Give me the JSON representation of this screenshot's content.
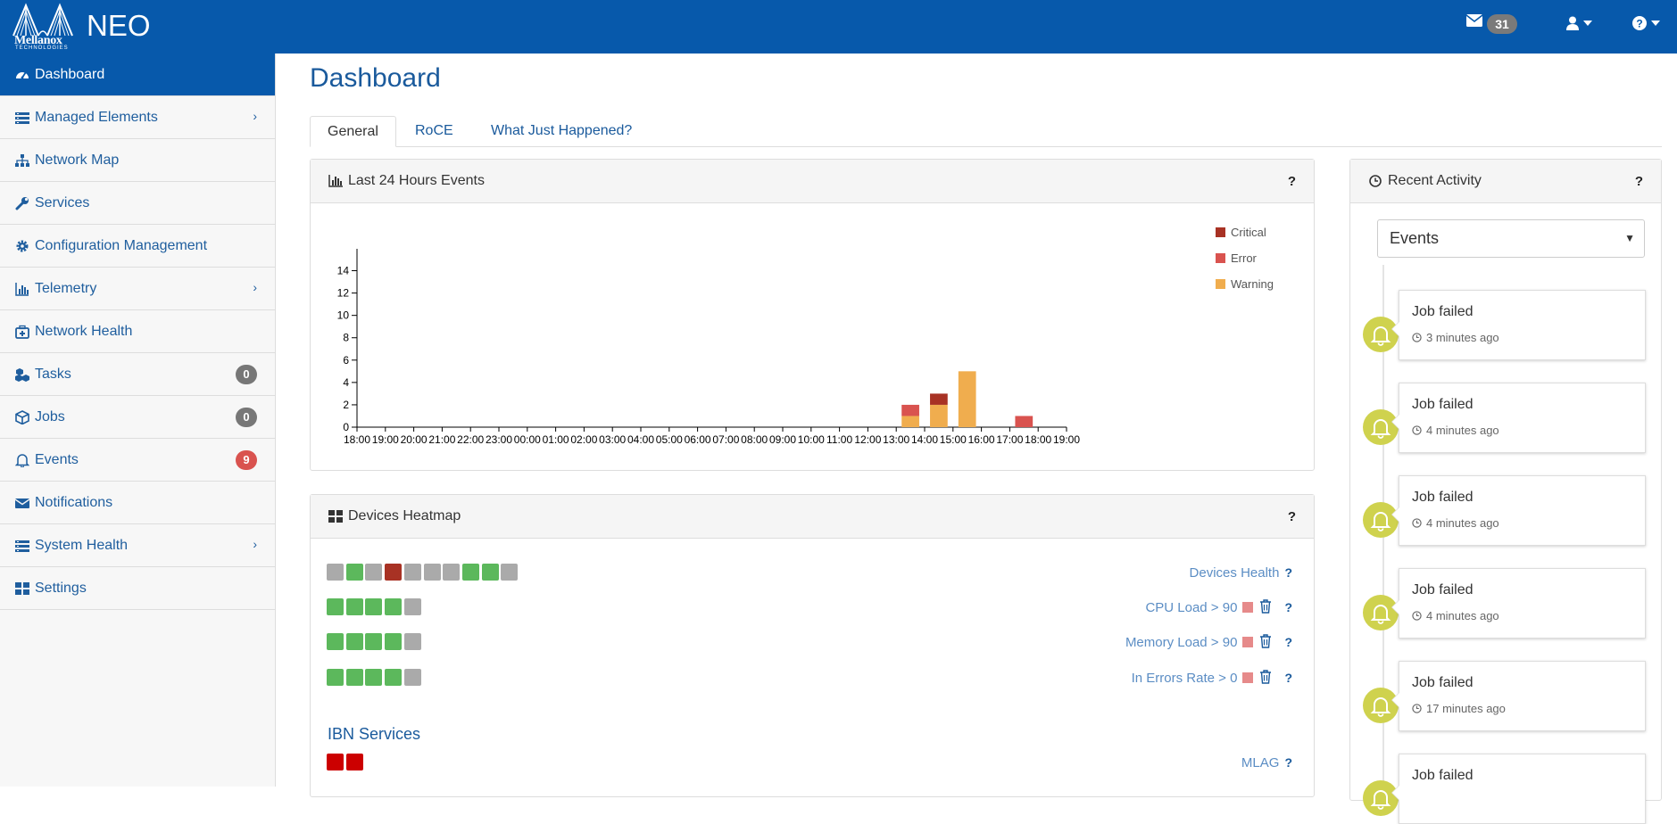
{
  "app": {
    "name": "NEO",
    "logo_word": "Mellanox",
    "logo_sub": "TECHNOLOGIES"
  },
  "header": {
    "mail_count": "31"
  },
  "sidebar": {
    "items": [
      {
        "label": "Dashboard",
        "icon": "dashboard-icon"
      },
      {
        "label": "Managed Elements",
        "icon": "managed-elements-icon",
        "chevron": true
      },
      {
        "label": "Network Map",
        "icon": "sitemap-icon"
      },
      {
        "label": "Services",
        "icon": "wrench-icon"
      },
      {
        "label": "Configuration Management",
        "icon": "gear-icon"
      },
      {
        "label": "Telemetry",
        "icon": "bar-chart-icon",
        "chevron": true
      },
      {
        "label": "Network Health",
        "icon": "medkit-icon"
      },
      {
        "label": "Tasks",
        "icon": "cubes-icon",
        "count": "0"
      },
      {
        "label": "Jobs",
        "icon": "cube-icon",
        "count": "0"
      },
      {
        "label": "Events",
        "icon": "bell-icon",
        "count": "9"
      },
      {
        "label": "Notifications",
        "icon": "envelope-icon"
      },
      {
        "label": "System Health",
        "icon": "server-icon",
        "chevron": true
      },
      {
        "label": "Settings",
        "icon": "grid-icon"
      }
    ]
  },
  "main": {
    "title": "Dashboard",
    "tabs": [
      "General",
      "RoCE",
      "What Just Happened?"
    ]
  },
  "events_panel": {
    "title": "Last 24 Hours Events",
    "help": "?"
  },
  "chart_data": {
    "type": "bar",
    "stacked": true,
    "categories": [
      "18:00",
      "19:00",
      "20:00",
      "21:00",
      "22:00",
      "23:00",
      "00:00",
      "01:00",
      "02:00",
      "03:00",
      "04:00",
      "05:00",
      "06:00",
      "07:00",
      "08:00",
      "09:00",
      "10:00",
      "11:00",
      "12:00",
      "13:00",
      "14:00",
      "15:00",
      "16:00",
      "17:00",
      "18:00",
      "19:00"
    ],
    "series": [
      {
        "name": "Warning",
        "color": "#f0ad4e",
        "values": [
          0,
          0,
          0,
          0,
          0,
          0,
          0,
          0,
          0,
          0,
          0,
          0,
          0,
          0,
          0,
          0,
          0,
          0,
          0,
          1,
          2,
          5,
          0,
          0,
          0,
          0
        ]
      },
      {
        "name": "Error",
        "color": "#d9534f",
        "values": [
          0,
          0,
          0,
          0,
          0,
          0,
          0,
          0,
          0,
          0,
          0,
          0,
          0,
          0,
          0,
          0,
          0,
          0,
          0,
          1,
          0,
          0,
          0,
          1,
          0,
          0
        ]
      },
      {
        "name": "Critical",
        "color": "#a83224",
        "values": [
          0,
          0,
          0,
          0,
          0,
          0,
          0,
          0,
          0,
          0,
          0,
          0,
          0,
          0,
          0,
          0,
          0,
          0,
          0,
          0,
          1,
          0,
          0,
          0,
          0,
          0
        ]
      }
    ],
    "legend_order": [
      "Critical",
      "Error",
      "Warning"
    ],
    "yticks": [
      "0",
      "2",
      "4",
      "6",
      "8",
      "10",
      "12",
      "14"
    ],
    "ylim": [
      0,
      15
    ],
    "legend": "top-right",
    "grid": false
  },
  "heatmap_panel": {
    "title": "Devices Heatmap",
    "help": "?",
    "rows": [
      {
        "label": "Devices Health",
        "cells": [
          "#aaaaaa",
          "#5cb85c",
          "#aaaaaa",
          "#a83224",
          "#aaaaaa",
          "#aaaaaa",
          "#aaaaaa",
          "#5cb85c",
          "#5cb85c",
          "#aaaaaa"
        ],
        "threshold": false
      },
      {
        "label": "CPU Load > 90",
        "cells": [
          "#5cb85c",
          "#5cb85c",
          "#5cb85c",
          "#5cb85c",
          "#aaaaaa"
        ],
        "threshold": true
      },
      {
        "label": "Memory Load > 90",
        "cells": [
          "#5cb85c",
          "#5cb85c",
          "#5cb85c",
          "#5cb85c",
          "#aaaaaa"
        ],
        "threshold": true
      },
      {
        "label": "In Errors Rate > 0",
        "cells": [
          "#5cb85c",
          "#5cb85c",
          "#5cb85c",
          "#5cb85c",
          "#aaaaaa"
        ],
        "threshold": true
      }
    ],
    "ibn_title": "IBN Services",
    "ibn_rows": [
      {
        "label": "MLAG",
        "cells": [
          "#cc0000",
          "#cc0000"
        ]
      }
    ]
  },
  "activity_panel": {
    "title": "Recent Activity",
    "help": "?",
    "select_value": "Events",
    "items": [
      {
        "title": "Job failed",
        "time": "3 minutes ago"
      },
      {
        "title": "Job failed",
        "time": "4 minutes ago"
      },
      {
        "title": "Job failed",
        "time": "4 minutes ago"
      },
      {
        "title": "Job failed",
        "time": "4 minutes ago"
      },
      {
        "title": "Job failed",
        "time": "17 minutes ago"
      },
      {
        "title": "Job failed",
        "time": ""
      }
    ]
  }
}
